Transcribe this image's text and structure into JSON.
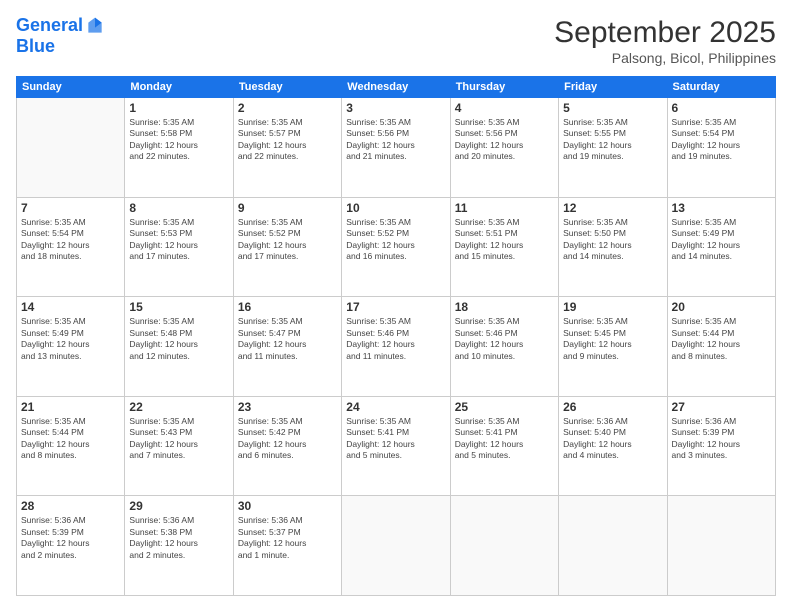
{
  "header": {
    "logo_line1": "General",
    "logo_line2": "Blue",
    "month": "September 2025",
    "location": "Palsong, Bicol, Philippines"
  },
  "weekdays": [
    "Sunday",
    "Monday",
    "Tuesday",
    "Wednesday",
    "Thursday",
    "Friday",
    "Saturday"
  ],
  "weeks": [
    [
      {
        "day": "",
        "info": ""
      },
      {
        "day": "1",
        "info": "Sunrise: 5:35 AM\nSunset: 5:58 PM\nDaylight: 12 hours\nand 22 minutes."
      },
      {
        "day": "2",
        "info": "Sunrise: 5:35 AM\nSunset: 5:57 PM\nDaylight: 12 hours\nand 22 minutes."
      },
      {
        "day": "3",
        "info": "Sunrise: 5:35 AM\nSunset: 5:56 PM\nDaylight: 12 hours\nand 21 minutes."
      },
      {
        "day": "4",
        "info": "Sunrise: 5:35 AM\nSunset: 5:56 PM\nDaylight: 12 hours\nand 20 minutes."
      },
      {
        "day": "5",
        "info": "Sunrise: 5:35 AM\nSunset: 5:55 PM\nDaylight: 12 hours\nand 19 minutes."
      },
      {
        "day": "6",
        "info": "Sunrise: 5:35 AM\nSunset: 5:54 PM\nDaylight: 12 hours\nand 19 minutes."
      }
    ],
    [
      {
        "day": "7",
        "info": "Sunrise: 5:35 AM\nSunset: 5:54 PM\nDaylight: 12 hours\nand 18 minutes."
      },
      {
        "day": "8",
        "info": "Sunrise: 5:35 AM\nSunset: 5:53 PM\nDaylight: 12 hours\nand 17 minutes."
      },
      {
        "day": "9",
        "info": "Sunrise: 5:35 AM\nSunset: 5:52 PM\nDaylight: 12 hours\nand 17 minutes."
      },
      {
        "day": "10",
        "info": "Sunrise: 5:35 AM\nSunset: 5:52 PM\nDaylight: 12 hours\nand 16 minutes."
      },
      {
        "day": "11",
        "info": "Sunrise: 5:35 AM\nSunset: 5:51 PM\nDaylight: 12 hours\nand 15 minutes."
      },
      {
        "day": "12",
        "info": "Sunrise: 5:35 AM\nSunset: 5:50 PM\nDaylight: 12 hours\nand 14 minutes."
      },
      {
        "day": "13",
        "info": "Sunrise: 5:35 AM\nSunset: 5:49 PM\nDaylight: 12 hours\nand 14 minutes."
      }
    ],
    [
      {
        "day": "14",
        "info": "Sunrise: 5:35 AM\nSunset: 5:49 PM\nDaylight: 12 hours\nand 13 minutes."
      },
      {
        "day": "15",
        "info": "Sunrise: 5:35 AM\nSunset: 5:48 PM\nDaylight: 12 hours\nand 12 minutes."
      },
      {
        "day": "16",
        "info": "Sunrise: 5:35 AM\nSunset: 5:47 PM\nDaylight: 12 hours\nand 11 minutes."
      },
      {
        "day": "17",
        "info": "Sunrise: 5:35 AM\nSunset: 5:46 PM\nDaylight: 12 hours\nand 11 minutes."
      },
      {
        "day": "18",
        "info": "Sunrise: 5:35 AM\nSunset: 5:46 PM\nDaylight: 12 hours\nand 10 minutes."
      },
      {
        "day": "19",
        "info": "Sunrise: 5:35 AM\nSunset: 5:45 PM\nDaylight: 12 hours\nand 9 minutes."
      },
      {
        "day": "20",
        "info": "Sunrise: 5:35 AM\nSunset: 5:44 PM\nDaylight: 12 hours\nand 8 minutes."
      }
    ],
    [
      {
        "day": "21",
        "info": "Sunrise: 5:35 AM\nSunset: 5:44 PM\nDaylight: 12 hours\nand 8 minutes."
      },
      {
        "day": "22",
        "info": "Sunrise: 5:35 AM\nSunset: 5:43 PM\nDaylight: 12 hours\nand 7 minutes."
      },
      {
        "day": "23",
        "info": "Sunrise: 5:35 AM\nSunset: 5:42 PM\nDaylight: 12 hours\nand 6 minutes."
      },
      {
        "day": "24",
        "info": "Sunrise: 5:35 AM\nSunset: 5:41 PM\nDaylight: 12 hours\nand 5 minutes."
      },
      {
        "day": "25",
        "info": "Sunrise: 5:35 AM\nSunset: 5:41 PM\nDaylight: 12 hours\nand 5 minutes."
      },
      {
        "day": "26",
        "info": "Sunrise: 5:36 AM\nSunset: 5:40 PM\nDaylight: 12 hours\nand 4 minutes."
      },
      {
        "day": "27",
        "info": "Sunrise: 5:36 AM\nSunset: 5:39 PM\nDaylight: 12 hours\nand 3 minutes."
      }
    ],
    [
      {
        "day": "28",
        "info": "Sunrise: 5:36 AM\nSunset: 5:39 PM\nDaylight: 12 hours\nand 2 minutes."
      },
      {
        "day": "29",
        "info": "Sunrise: 5:36 AM\nSunset: 5:38 PM\nDaylight: 12 hours\nand 2 minutes."
      },
      {
        "day": "30",
        "info": "Sunrise: 5:36 AM\nSunset: 5:37 PM\nDaylight: 12 hours\nand 1 minute."
      },
      {
        "day": "",
        "info": ""
      },
      {
        "day": "",
        "info": ""
      },
      {
        "day": "",
        "info": ""
      },
      {
        "day": "",
        "info": ""
      }
    ]
  ]
}
